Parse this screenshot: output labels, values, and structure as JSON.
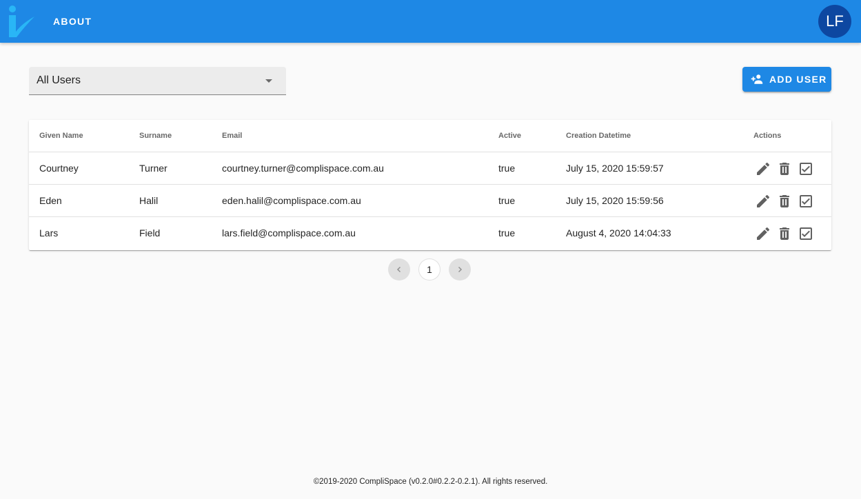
{
  "header": {
    "about_label": "ABOUT",
    "avatar_initials": "LF",
    "accent_color": "#1e88e5"
  },
  "filter": {
    "selected": "All Users"
  },
  "add_user_label": "ADD USER",
  "table": {
    "columns": [
      "Given Name",
      "Surname",
      "Email",
      "Active",
      "Creation Datetime",
      "Actions"
    ],
    "rows": [
      {
        "given": "Courtney",
        "surname": "Turner",
        "email": "courtney.turner@complispace.com.au",
        "active": "true",
        "created": "July 15, 2020 15:59:57"
      },
      {
        "given": "Eden",
        "surname": "Halil",
        "email": "eden.halil@complispace.com.au",
        "active": "true",
        "created": "July 15, 2020 15:59:56"
      },
      {
        "given": "Lars",
        "surname": "Field",
        "email": "lars.field@complispace.com.au",
        "active": "true",
        "created": "August 4, 2020 14:04:33"
      }
    ],
    "row_actions": [
      "pencil-icon",
      "trash-icon",
      "checkbox-icon"
    ]
  },
  "pagination": {
    "prev_icon": "chevron-left-icon",
    "current_page": "1",
    "next_icon": "chevron-right-icon"
  },
  "footer": {
    "text": "©2019-2020 CompliSpace (v0.2.0#0.2.2-0.2.1). All rights reserved."
  }
}
